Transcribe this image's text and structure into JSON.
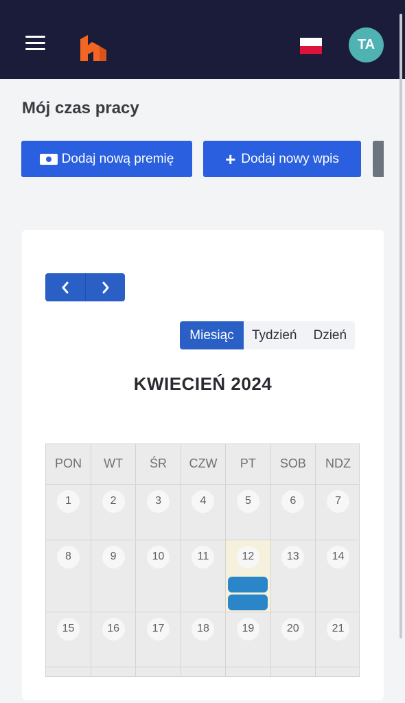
{
  "header": {
    "menu_icon": "hamburger-icon",
    "logo_icon": "logo-h",
    "language_flag": "poland-flag-icon",
    "flag_colors": [
      "#ffffff",
      "#dc143c"
    ],
    "avatar_initials": "TA",
    "avatar_color": "#4fb3b3",
    "background": "#1b1c3a"
  },
  "page": {
    "title": "Mój czas pracy"
  },
  "actions": {
    "add_bonus_label": "Dodaj nową premię",
    "add_bonus_icon": "money-bill-icon",
    "add_entry_label": "Dodaj nowy wpis",
    "add_entry_icon": "plus-icon",
    "primary_color": "#2a5fdf"
  },
  "calendar": {
    "nav": {
      "prev_icon": "chevron-left-icon",
      "next_icon": "chevron-right-icon"
    },
    "views": [
      "Miesiąc",
      "Tydzień",
      "Dzień"
    ],
    "active_view": "Miesiąc",
    "month_title": "KWIECIEŃ 2024",
    "weekdays": [
      "PON",
      "WT",
      "ŚR",
      "CZW",
      "PT",
      "SOB",
      "NDZ"
    ],
    "weeks": [
      [
        "1",
        "2",
        "3",
        "4",
        "5",
        "6",
        "7"
      ],
      [
        "8",
        "9",
        "10",
        "11",
        "12",
        "13",
        "14"
      ],
      [
        "15",
        "16",
        "17",
        "18",
        "19",
        "20",
        "21"
      ]
    ],
    "today": "12",
    "event_color": "#2a86c8",
    "event_day": "12",
    "event_count": 2
  }
}
